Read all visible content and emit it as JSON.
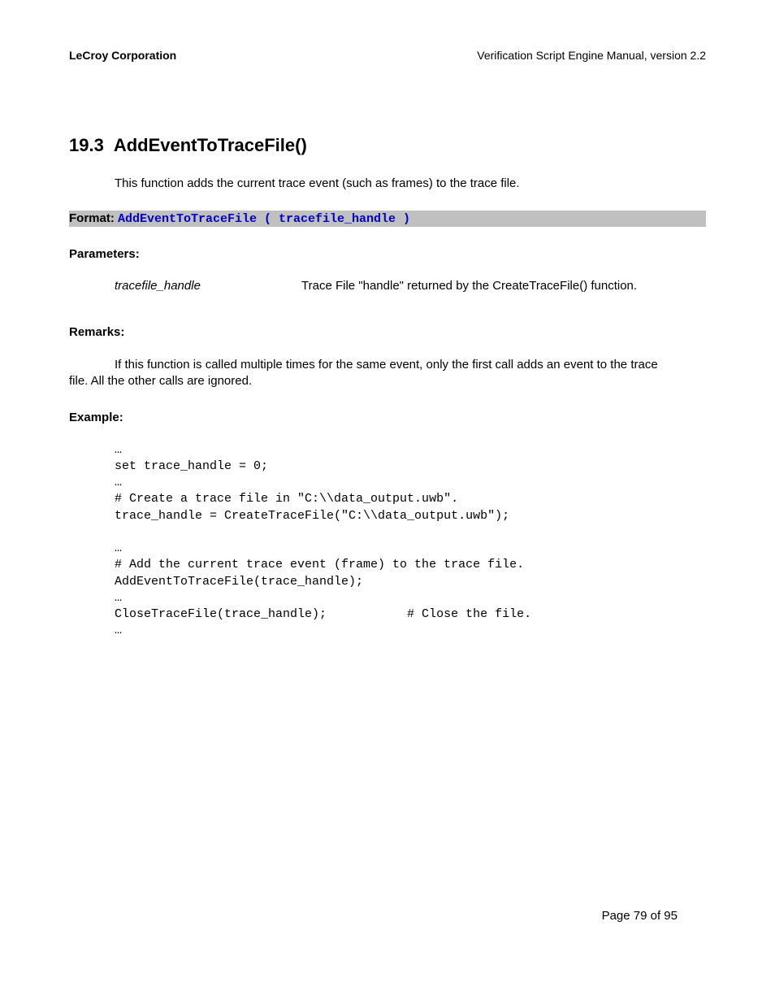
{
  "header": {
    "left": "LeCroy Corporation",
    "right": "Verification Script Engine Manual, version 2.2"
  },
  "section": {
    "number": "19.3",
    "title": "AddEventToTraceFile()",
    "description": "This function adds the current trace event (such as frames) to the trace file."
  },
  "format": {
    "label": "Format: ",
    "code": "AddEventToTraceFile ( tracefile_handle )"
  },
  "parameters": {
    "label": "Parameters:",
    "items": [
      {
        "name": "tracefile_handle",
        "desc": "Trace File \"handle\" returned by the CreateTraceFile() function."
      }
    ]
  },
  "remarks": {
    "label": "Remarks:",
    "text_line1": "If this function is called multiple times for the same event, only the first call adds an event to the trace",
    "text_line2": "file. All the other calls are ignored."
  },
  "example": {
    "label": "Example:",
    "code": "…\nset trace_handle = 0;\n…\n# Create a trace file in \"C:\\\\data_output.uwb\".\ntrace_handle = CreateTraceFile(\"C:\\\\data_output.uwb\");\n\n…\n# Add the current trace event (frame) to the trace file.\nAddEventToTraceFile(trace_handle);\n…\nCloseTraceFile(trace_handle);           # Close the file.\n…"
  },
  "footer": {
    "page": "Page 79 of 95"
  }
}
